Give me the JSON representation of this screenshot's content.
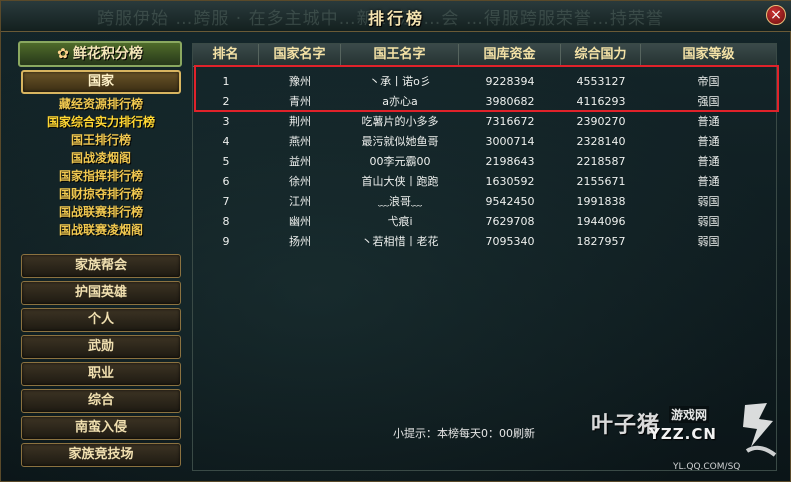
{
  "window": {
    "title": "排行榜",
    "close_label": "×",
    "ghost_text": "跨服伊始 …跨服 · 在多主城中…新 …江 …会 …得服跨服荣誉…持荣誉"
  },
  "sidebar": {
    "top_tab": {
      "label": "鲜花积分榜",
      "icon": "flower-icon"
    },
    "active_category": "国家",
    "sub_items": [
      "藏经资源排行榜",
      "国家综合实力排行榜",
      "国王排行榜",
      "国战凌烟阁",
      "国家指挥排行榜",
      "国财掠夺排行榜",
      "国战联赛排行榜",
      "国战联赛凌烟阁"
    ],
    "current_sub_index": 1,
    "categories": [
      "家族帮会",
      "护国英雄",
      "个人",
      "武勋",
      "职业",
      "综合",
      "南蛮入侵",
      "家族竞技场"
    ]
  },
  "table": {
    "columns": [
      "排名",
      "国家名字",
      "国王名字",
      "国库资金",
      "综合国力",
      "国家等级"
    ],
    "rows": [
      [
        "1",
        "豫州",
        "丶承丨诺o彡",
        "9228394",
        "4553127",
        "帝国"
      ],
      [
        "2",
        "青州",
        "a亦心a",
        "3980682",
        "4116293",
        "强国"
      ],
      [
        "3",
        "荆州",
        "吃薯片的小多多",
        "7316672",
        "2390270",
        "普通"
      ],
      [
        "4",
        "燕州",
        "最污就似她鱼哥",
        "3000714",
        "2328140",
        "普通"
      ],
      [
        "5",
        "益州",
        "00李元霸00",
        "2198643",
        "2218587",
        "普通"
      ],
      [
        "6",
        "徐州",
        "首山大侠丨跑跑",
        "1630592",
        "2155671",
        "普通"
      ],
      [
        "7",
        "江州",
        "﹏浪哥﹏",
        "9542450",
        "1991838",
        "弱国"
      ],
      [
        "8",
        "幽州",
        "弋痕i",
        "7629708",
        "1944096",
        "弱国"
      ],
      [
        "9",
        "扬州",
        "丶若相惜丨老花",
        "7095340",
        "1827957",
        "弱国"
      ]
    ]
  },
  "tip": "小提示：本榜每天0：00刷新",
  "watermark": {
    "brand": "叶子猪",
    "tag": "游戏网",
    "url": "YZZ.CN",
    "sub": "YL.QQ.COM/SQ"
  },
  "colors": {
    "highlight": "#e0222a",
    "sub_item": "#f0c850",
    "header_text": "#f4e2a6"
  }
}
